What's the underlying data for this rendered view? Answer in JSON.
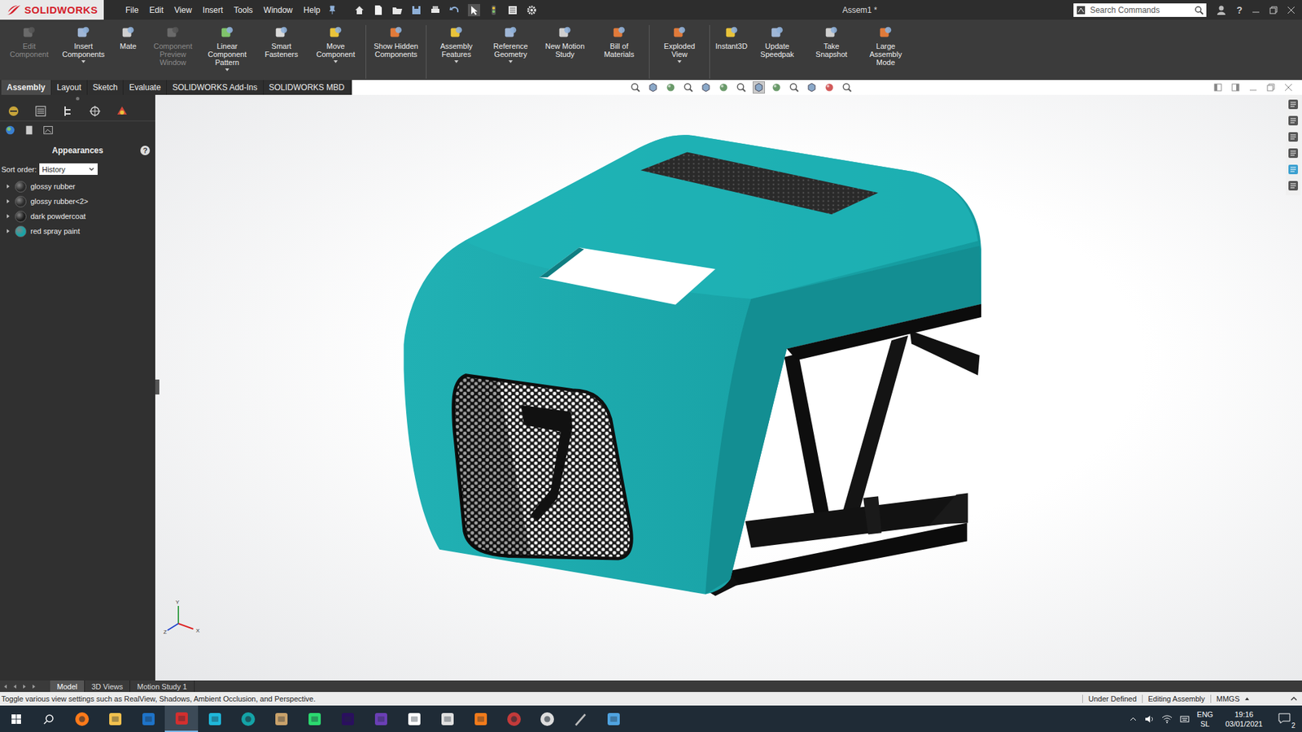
{
  "window": {
    "title": "Assem1 *",
    "app": "SOLIDWORKS"
  },
  "menu": [
    "File",
    "Edit",
    "View",
    "Insert",
    "Tools",
    "Window",
    "Help"
  ],
  "search": {
    "placeholder": "Search Commands"
  },
  "help_glyph": "?",
  "ribbon": {
    "groups": [
      [
        {
          "label": "Edit Component",
          "disabled": true,
          "dropdown": false
        },
        {
          "label": "Insert Components",
          "disabled": false,
          "dropdown": true
        },
        {
          "label": "Mate",
          "disabled": false,
          "dropdown": false
        },
        {
          "label": "Component Preview Window",
          "disabled": true,
          "dropdown": false
        },
        {
          "label": "Linear Component Pattern",
          "disabled": false,
          "dropdown": true
        },
        {
          "label": "Smart Fasteners",
          "disabled": false,
          "dropdown": false
        },
        {
          "label": "Move Component",
          "disabled": false,
          "dropdown": true
        }
      ],
      [
        {
          "label": "Show Hidden Components",
          "disabled": false,
          "dropdown": false
        }
      ],
      [
        {
          "label": "Assembly Features",
          "disabled": false,
          "dropdown": true
        },
        {
          "label": "Reference Geometry",
          "disabled": false,
          "dropdown": true
        },
        {
          "label": "New Motion Study",
          "disabled": false,
          "dropdown": false
        },
        {
          "label": "Bill of Materials",
          "disabled": false,
          "dropdown": false
        }
      ],
      [
        {
          "label": "Exploded View",
          "disabled": false,
          "dropdown": true
        }
      ],
      [
        {
          "label": "Instant3D",
          "disabled": false,
          "dropdown": false
        },
        {
          "label": "Update Speedpak",
          "disabled": false,
          "dropdown": false
        },
        {
          "label": "Take Snapshot",
          "disabled": false,
          "dropdown": false
        },
        {
          "label": "Large Assembly Mode",
          "disabled": false,
          "dropdown": false
        }
      ]
    ]
  },
  "command_tabs": [
    {
      "label": "Assembly",
      "selected": true
    },
    {
      "label": "Layout",
      "selected": false
    },
    {
      "label": "Sketch",
      "selected": false
    },
    {
      "label": "Evaluate",
      "selected": false
    },
    {
      "label": "SOLIDWORKS Add-Ins",
      "selected": false
    },
    {
      "label": "SOLIDWORKS MBD",
      "selected": false
    }
  ],
  "panel": {
    "title": "Appearances",
    "help": "?",
    "sort_label": "Sort order:",
    "sort_value": "History",
    "items": [
      {
        "name": "glossy rubber",
        "color": "#2b2b2b"
      },
      {
        "name": "glossy rubber<2>",
        "color": "#2b2b2b"
      },
      {
        "name": "dark powdercoat",
        "color": "#1e1e1e"
      },
      {
        "name": "red spray paint",
        "color": "#1aa3a6"
      }
    ]
  },
  "triad": [
    "Y",
    "Z",
    "X"
  ],
  "bottom_tabs": [
    {
      "label": "Model",
      "selected": true
    },
    {
      "label": "3D Views",
      "selected": false
    },
    {
      "label": "Motion Study 1",
      "selected": false
    }
  ],
  "status_bar": {
    "message": "Toggle various view settings such as RealView, Shadows, Ambient Occlusion, and Perspective.",
    "items": [
      "Under Defined",
      "Editing Assembly",
      "MMGS"
    ]
  },
  "taskbar": {
    "apps": [
      {
        "kind": "firefox",
        "selected": false
      },
      {
        "kind": "explorer",
        "selected": false
      },
      {
        "kind": "outlook",
        "selected": false
      },
      {
        "kind": "solidworks",
        "selected": true
      },
      {
        "kind": "ccleaner",
        "selected": false
      },
      {
        "kind": "arduino",
        "selected": false
      },
      {
        "kind": "archive",
        "selected": false
      },
      {
        "kind": "pycharm",
        "selected": false
      },
      {
        "kind": "premiere",
        "selected": false
      },
      {
        "kind": "visualstudio",
        "selected": false
      },
      {
        "kind": "inkscape",
        "selected": false
      },
      {
        "kind": "xd",
        "selected": false
      },
      {
        "kind": "blender",
        "selected": false
      },
      {
        "kind": "davinci",
        "selected": false
      },
      {
        "kind": "obs",
        "selected": false
      },
      {
        "kind": "pen",
        "selected": false
      },
      {
        "kind": "notepad",
        "selected": false
      }
    ],
    "lang": [
      "ENG",
      "SL"
    ],
    "time": "19:16",
    "date": "03/01/2021",
    "notifications": "2"
  }
}
